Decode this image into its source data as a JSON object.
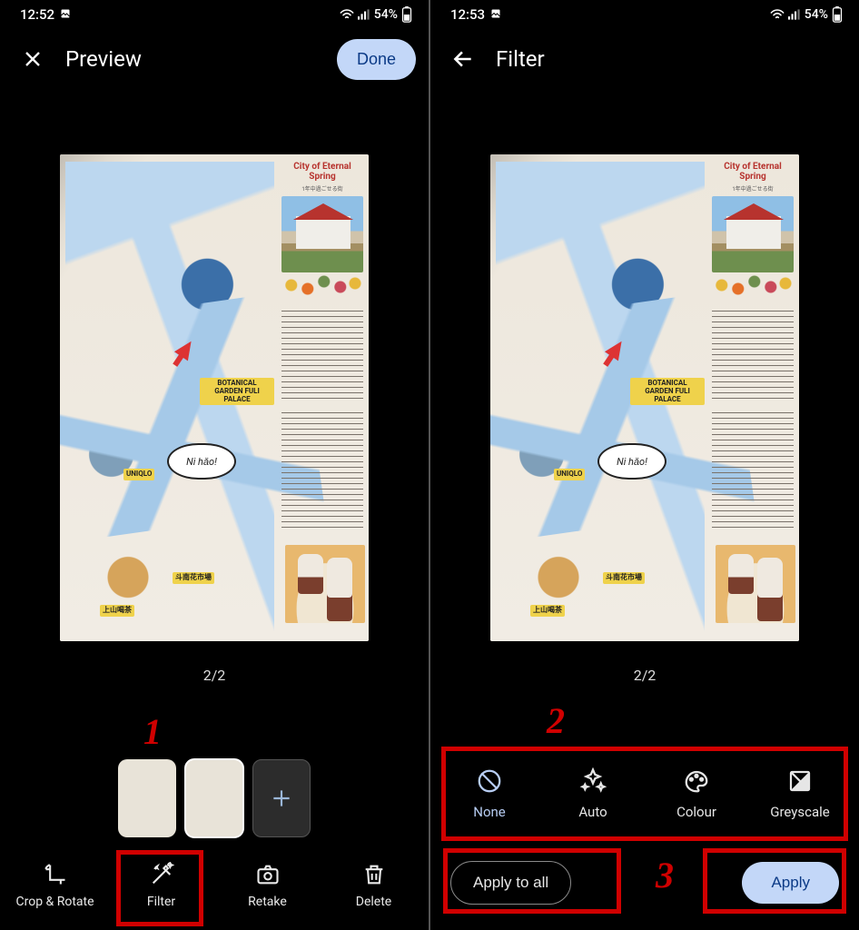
{
  "left": {
    "status": {
      "time": "12:52",
      "battery": "54%"
    },
    "header": {
      "title": "Preview",
      "done": "Done"
    },
    "pager": "2/2",
    "toolbar": {
      "crop": "Crop & Rotate",
      "filter": "Filter",
      "retake": "Retake",
      "delete": "Delete"
    },
    "annotation_number": "1"
  },
  "right": {
    "status": {
      "time": "12:53",
      "battery": "54%"
    },
    "header": {
      "title": "Filter"
    },
    "pager": "2/2",
    "filters": {
      "none": "None",
      "auto": "Auto",
      "colour": "Colour",
      "greyscale": "Greyscale"
    },
    "apply_all": "Apply to all",
    "apply": "Apply",
    "annotation_numbers": {
      "top": "2",
      "bottom": "3"
    }
  },
  "doc": {
    "headline": "City of Eternal Spring",
    "bubble": "Ni hǎo!",
    "tags": {
      "garden": "BOTANICAL GARDEN FULI PALACE",
      "uniqlo": "UNIQLO",
      "tea": "上山喝茶",
      "market": "斗南花市場"
    }
  }
}
